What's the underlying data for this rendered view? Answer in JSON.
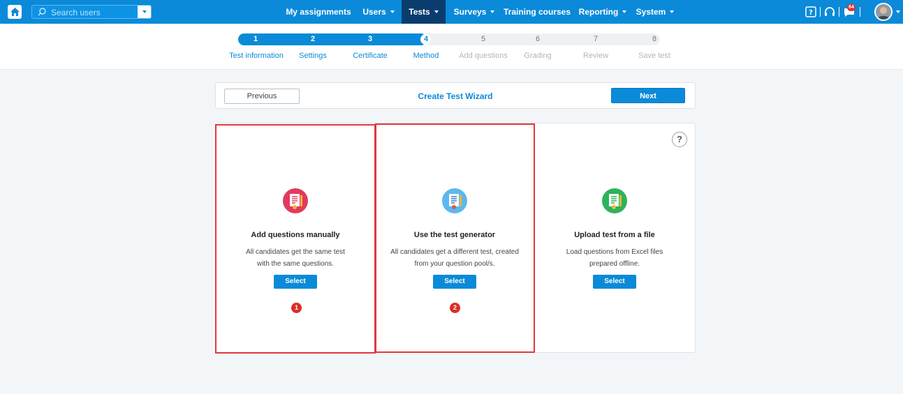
{
  "topbar": {
    "search_placeholder": "Search users",
    "nav": [
      {
        "label": "My assignments"
      },
      {
        "label": "Users"
      },
      {
        "label": "Tests"
      },
      {
        "label": "Surveys"
      },
      {
        "label": "Training courses"
      },
      {
        "label": "Reporting"
      },
      {
        "label": "System"
      }
    ],
    "notification_count": "64"
  },
  "steps": [
    {
      "num": "1",
      "label": "Test information"
    },
    {
      "num": "2",
      "label": "Settings"
    },
    {
      "num": "3",
      "label": "Certificate"
    },
    {
      "num": "4",
      "label": "Method"
    },
    {
      "num": "5",
      "label": "Add questions"
    },
    {
      "num": "6",
      "label": "Grading"
    },
    {
      "num": "7",
      "label": "Review"
    },
    {
      "num": "8",
      "label": "Save test"
    }
  ],
  "wizard": {
    "previous_label": "Previous",
    "title": "Create Test Wizard",
    "next_label": "Next"
  },
  "help_label": "?",
  "cards": [
    {
      "title": "Add questions manually",
      "desc_line1": "All candidates get the same test",
      "desc_line2": "with the same questions.",
      "select_label": "Select",
      "marker": "1",
      "icon_color": "#e23a5e"
    },
    {
      "title": "Use the test generator",
      "desc_line1": "All candidates get a different test, created",
      "desc_line2": "from your question pool/s.",
      "select_label": "Select",
      "marker": "2",
      "icon_color": "#5bb8ef"
    },
    {
      "title": "Upload test from a file",
      "desc_line1": "Load questions from Excel files",
      "desc_line2": "prepared offline.",
      "select_label": "Select",
      "icon_color": "#2db35a"
    }
  ],
  "colors": {
    "brand": "#0a8ad8",
    "nav_active": "#0a3d6e",
    "highlight": "#e0383e"
  }
}
